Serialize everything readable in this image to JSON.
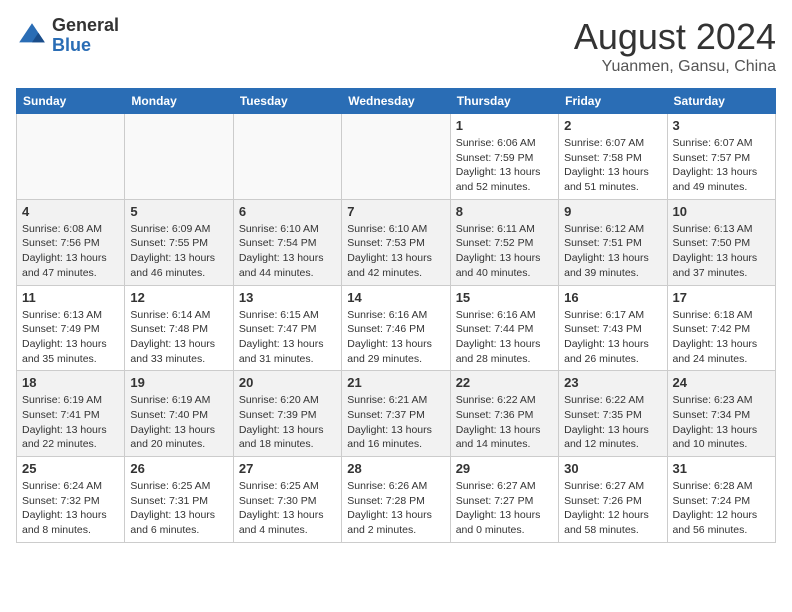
{
  "header": {
    "logo_general": "General",
    "logo_blue": "Blue",
    "month_year": "August 2024",
    "location": "Yuanmen, Gansu, China"
  },
  "weekdays": [
    "Sunday",
    "Monday",
    "Tuesday",
    "Wednesday",
    "Thursday",
    "Friday",
    "Saturday"
  ],
  "weeks": [
    [
      {
        "day": "",
        "info": ""
      },
      {
        "day": "",
        "info": ""
      },
      {
        "day": "",
        "info": ""
      },
      {
        "day": "",
        "info": ""
      },
      {
        "day": "1",
        "info": "Sunrise: 6:06 AM\nSunset: 7:59 PM\nDaylight: 13 hours\nand 52 minutes."
      },
      {
        "day": "2",
        "info": "Sunrise: 6:07 AM\nSunset: 7:58 PM\nDaylight: 13 hours\nand 51 minutes."
      },
      {
        "day": "3",
        "info": "Sunrise: 6:07 AM\nSunset: 7:57 PM\nDaylight: 13 hours\nand 49 minutes."
      }
    ],
    [
      {
        "day": "4",
        "info": "Sunrise: 6:08 AM\nSunset: 7:56 PM\nDaylight: 13 hours\nand 47 minutes."
      },
      {
        "day": "5",
        "info": "Sunrise: 6:09 AM\nSunset: 7:55 PM\nDaylight: 13 hours\nand 46 minutes."
      },
      {
        "day": "6",
        "info": "Sunrise: 6:10 AM\nSunset: 7:54 PM\nDaylight: 13 hours\nand 44 minutes."
      },
      {
        "day": "7",
        "info": "Sunrise: 6:10 AM\nSunset: 7:53 PM\nDaylight: 13 hours\nand 42 minutes."
      },
      {
        "day": "8",
        "info": "Sunrise: 6:11 AM\nSunset: 7:52 PM\nDaylight: 13 hours\nand 40 minutes."
      },
      {
        "day": "9",
        "info": "Sunrise: 6:12 AM\nSunset: 7:51 PM\nDaylight: 13 hours\nand 39 minutes."
      },
      {
        "day": "10",
        "info": "Sunrise: 6:13 AM\nSunset: 7:50 PM\nDaylight: 13 hours\nand 37 minutes."
      }
    ],
    [
      {
        "day": "11",
        "info": "Sunrise: 6:13 AM\nSunset: 7:49 PM\nDaylight: 13 hours\nand 35 minutes."
      },
      {
        "day": "12",
        "info": "Sunrise: 6:14 AM\nSunset: 7:48 PM\nDaylight: 13 hours\nand 33 minutes."
      },
      {
        "day": "13",
        "info": "Sunrise: 6:15 AM\nSunset: 7:47 PM\nDaylight: 13 hours\nand 31 minutes."
      },
      {
        "day": "14",
        "info": "Sunrise: 6:16 AM\nSunset: 7:46 PM\nDaylight: 13 hours\nand 29 minutes."
      },
      {
        "day": "15",
        "info": "Sunrise: 6:16 AM\nSunset: 7:44 PM\nDaylight: 13 hours\nand 28 minutes."
      },
      {
        "day": "16",
        "info": "Sunrise: 6:17 AM\nSunset: 7:43 PM\nDaylight: 13 hours\nand 26 minutes."
      },
      {
        "day": "17",
        "info": "Sunrise: 6:18 AM\nSunset: 7:42 PM\nDaylight: 13 hours\nand 24 minutes."
      }
    ],
    [
      {
        "day": "18",
        "info": "Sunrise: 6:19 AM\nSunset: 7:41 PM\nDaylight: 13 hours\nand 22 minutes."
      },
      {
        "day": "19",
        "info": "Sunrise: 6:19 AM\nSunset: 7:40 PM\nDaylight: 13 hours\nand 20 minutes."
      },
      {
        "day": "20",
        "info": "Sunrise: 6:20 AM\nSunset: 7:39 PM\nDaylight: 13 hours\nand 18 minutes."
      },
      {
        "day": "21",
        "info": "Sunrise: 6:21 AM\nSunset: 7:37 PM\nDaylight: 13 hours\nand 16 minutes."
      },
      {
        "day": "22",
        "info": "Sunrise: 6:22 AM\nSunset: 7:36 PM\nDaylight: 13 hours\nand 14 minutes."
      },
      {
        "day": "23",
        "info": "Sunrise: 6:22 AM\nSunset: 7:35 PM\nDaylight: 13 hours\nand 12 minutes."
      },
      {
        "day": "24",
        "info": "Sunrise: 6:23 AM\nSunset: 7:34 PM\nDaylight: 13 hours\nand 10 minutes."
      }
    ],
    [
      {
        "day": "25",
        "info": "Sunrise: 6:24 AM\nSunset: 7:32 PM\nDaylight: 13 hours\nand 8 minutes."
      },
      {
        "day": "26",
        "info": "Sunrise: 6:25 AM\nSunset: 7:31 PM\nDaylight: 13 hours\nand 6 minutes."
      },
      {
        "day": "27",
        "info": "Sunrise: 6:25 AM\nSunset: 7:30 PM\nDaylight: 13 hours\nand 4 minutes."
      },
      {
        "day": "28",
        "info": "Sunrise: 6:26 AM\nSunset: 7:28 PM\nDaylight: 13 hours\nand 2 minutes."
      },
      {
        "day": "29",
        "info": "Sunrise: 6:27 AM\nSunset: 7:27 PM\nDaylight: 13 hours\nand 0 minutes."
      },
      {
        "day": "30",
        "info": "Sunrise: 6:27 AM\nSunset: 7:26 PM\nDaylight: 12 hours\nand 58 minutes."
      },
      {
        "day": "31",
        "info": "Sunrise: 6:28 AM\nSunset: 7:24 PM\nDaylight: 12 hours\nand 56 minutes."
      }
    ]
  ]
}
